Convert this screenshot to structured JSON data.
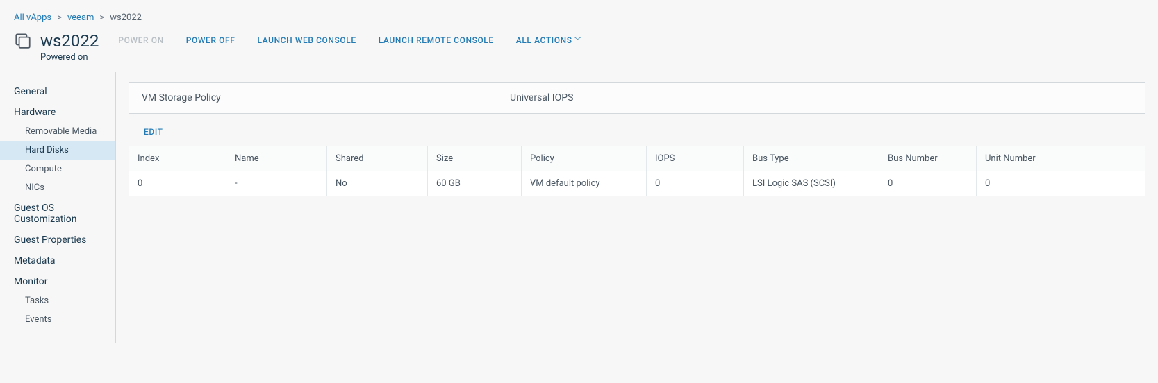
{
  "breadcrumb": {
    "items": [
      {
        "label": "All vApps"
      },
      {
        "label": "veeam"
      }
    ],
    "current": "ws2022"
  },
  "header": {
    "title": "ws2022",
    "status": "Powered on",
    "actions": {
      "power_on": "POWER ON",
      "power_off": "POWER OFF",
      "launch_web": "LAUNCH WEB CONSOLE",
      "launch_remote": "LAUNCH REMOTE CONSOLE",
      "all_actions": "ALL ACTIONS"
    }
  },
  "sidebar": {
    "general": "General",
    "hardware": {
      "label": "Hardware",
      "items": [
        {
          "label": "Removable Media"
        },
        {
          "label": "Hard Disks"
        },
        {
          "label": "Compute"
        },
        {
          "label": "NICs"
        }
      ]
    },
    "guest_os": "Guest OS Customization",
    "guest_props": "Guest Properties",
    "metadata": "Metadata",
    "monitor": {
      "label": "Monitor",
      "items": [
        {
          "label": "Tasks"
        },
        {
          "label": "Events"
        }
      ]
    }
  },
  "content": {
    "policy": {
      "label": "VM Storage Policy",
      "value": "Universal IOPS"
    },
    "edit": "EDIT",
    "table": {
      "headers": {
        "index": "Index",
        "name": "Name",
        "shared": "Shared",
        "size": "Size",
        "policy": "Policy",
        "iops": "IOPS",
        "bus_type": "Bus Type",
        "bus_number": "Bus Number",
        "unit_number": "Unit Number"
      },
      "rows": [
        {
          "index": "0",
          "name": "-",
          "shared": "No",
          "size": "60 GB",
          "policy": "VM default policy",
          "iops": "0",
          "bus_type": "LSI Logic SAS (SCSI)",
          "bus_number": "0",
          "unit_number": "0"
        }
      ]
    }
  }
}
